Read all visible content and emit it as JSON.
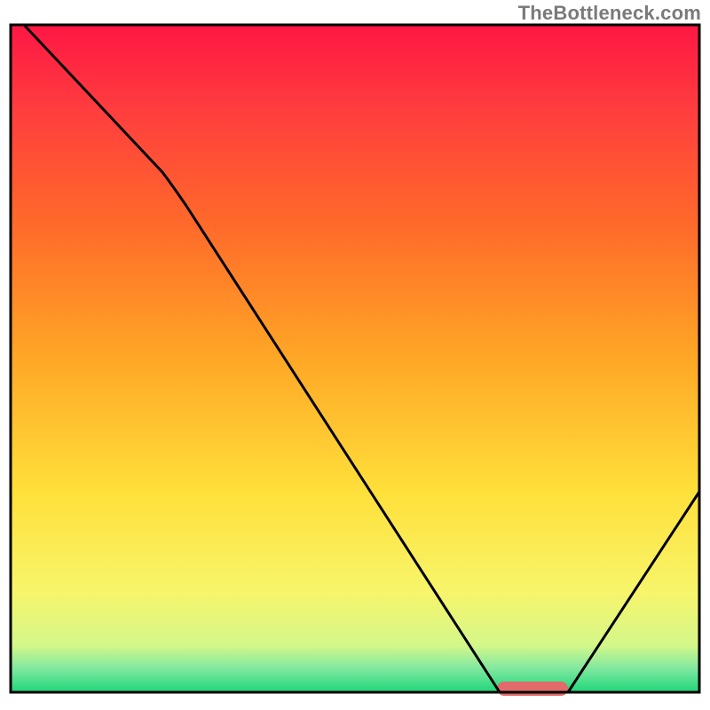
{
  "watermark": "TheBottleneck.com",
  "chart_data": {
    "type": "line",
    "title": "",
    "xlabel": "",
    "ylabel": "",
    "xlim": [
      0,
      100
    ],
    "ylim": [
      0,
      100
    ],
    "grid": false,
    "legend": false,
    "series": [
      {
        "name": "bottleneck-curve",
        "x": [
          2,
          22,
          71,
          81,
          100
        ],
        "y": [
          100,
          78,
          0,
          0,
          30
        ],
        "color": "#000000"
      }
    ],
    "marker": {
      "name": "optimal-range",
      "x_start": 71,
      "x_end": 81,
      "y": 0,
      "color": "#e26a6a"
    },
    "background_gradient": {
      "stops": [
        {
          "offset": 0.0,
          "color": "#ff1744"
        },
        {
          "offset": 0.12,
          "color": "#ff3b3f"
        },
        {
          "offset": 0.3,
          "color": "#ff6a2a"
        },
        {
          "offset": 0.5,
          "color": "#ffa726"
        },
        {
          "offset": 0.7,
          "color": "#ffe03a"
        },
        {
          "offset": 0.85,
          "color": "#f7f56b"
        },
        {
          "offset": 0.93,
          "color": "#d4f78a"
        },
        {
          "offset": 0.965,
          "color": "#7fe8a0"
        },
        {
          "offset": 1.0,
          "color": "#1ed67a"
        }
      ]
    },
    "frame_color": "#000000"
  }
}
